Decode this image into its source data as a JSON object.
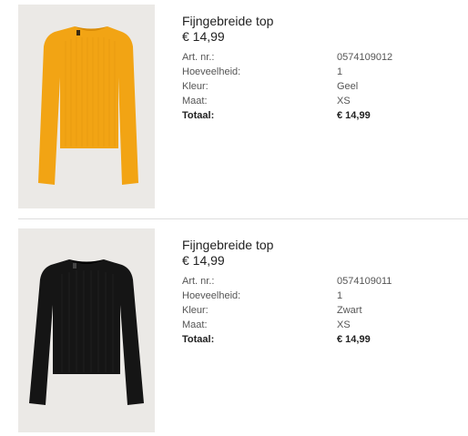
{
  "items": [
    {
      "title": "Fijngebreide top",
      "price": "€ 14,99",
      "art_label": "Art. nr.:",
      "art_value": "0574109012",
      "qty_label": "Hoeveelheid:",
      "qty_value": "1",
      "color_label": "Kleur:",
      "color_value": "Geel",
      "size_label": "Maat:",
      "size_value": "XS",
      "total_label": "Totaal:",
      "total_value": "€ 14,99",
      "garment_color": "#f2a414"
    },
    {
      "title": "Fijngebreide top",
      "price": "€ 14,99",
      "art_label": "Art. nr.:",
      "art_value": "0574109011",
      "qty_label": "Hoeveelheid:",
      "qty_value": "1",
      "color_label": "Kleur:",
      "color_value": "Zwart",
      "size_label": "Maat:",
      "size_value": "XS",
      "total_label": "Totaal:",
      "total_value": "€ 14,99",
      "garment_color": "#151515"
    }
  ]
}
